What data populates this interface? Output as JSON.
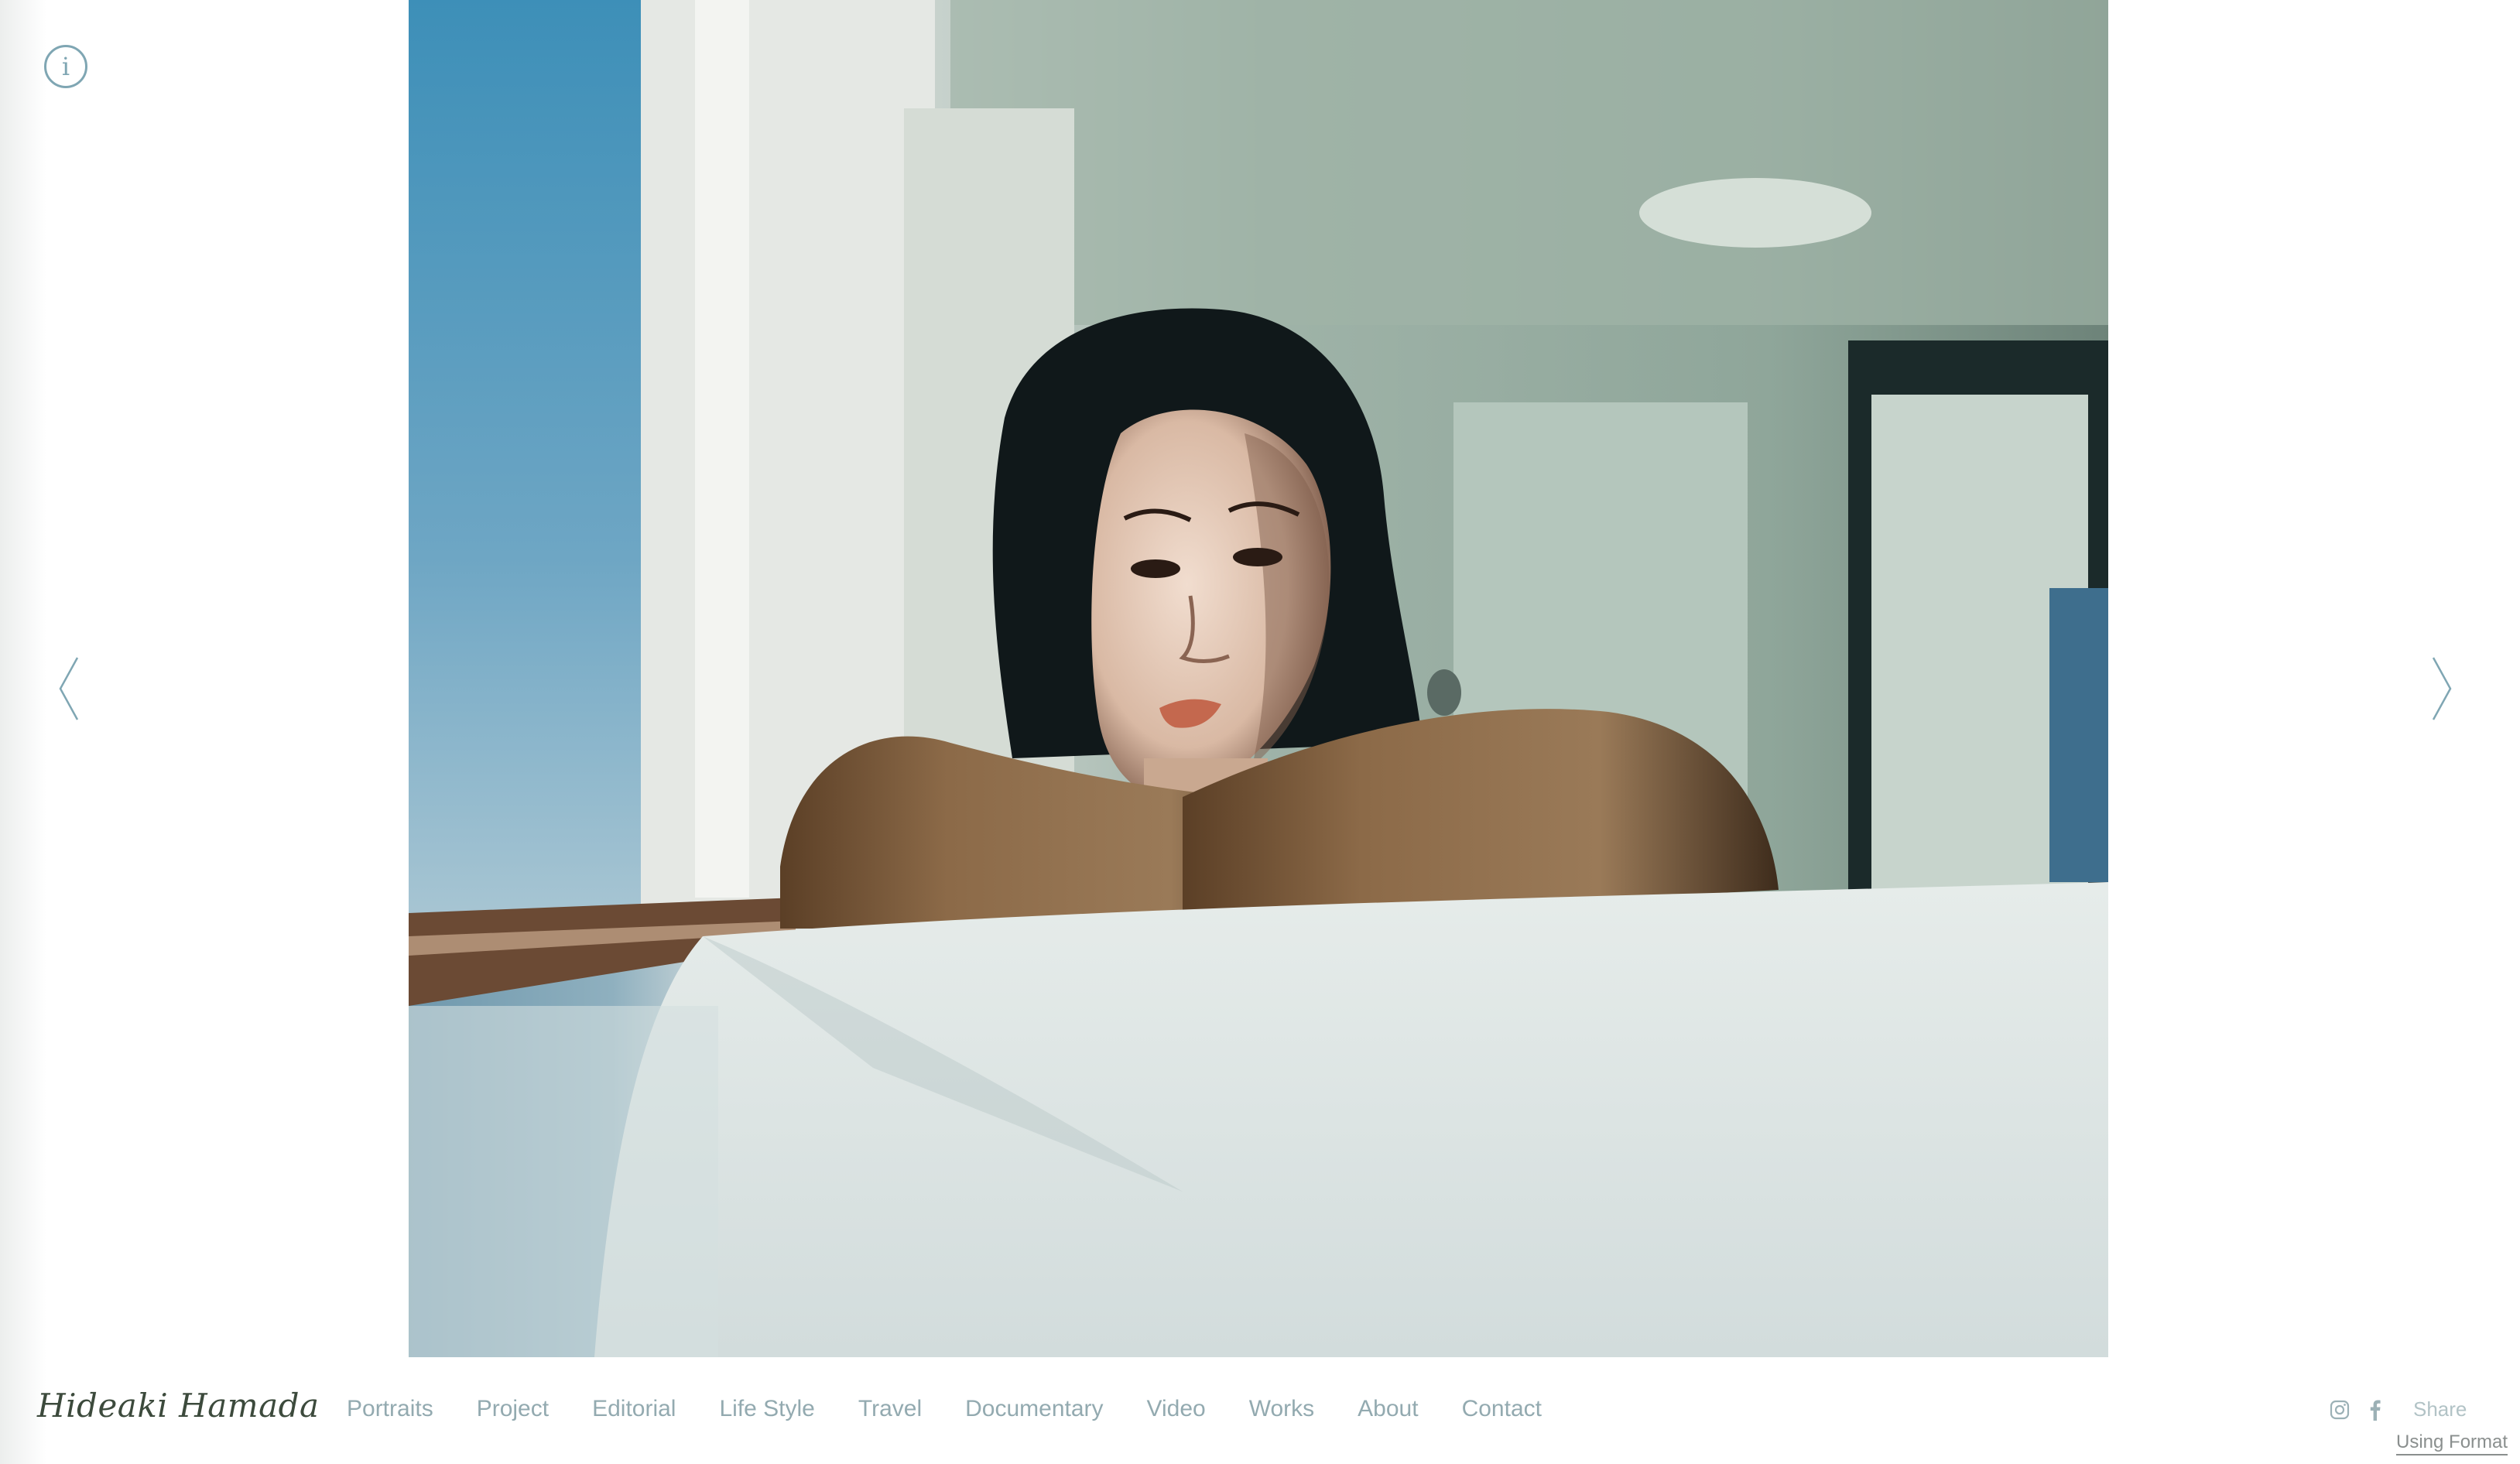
{
  "site": {
    "title": "Hideaki Hamada"
  },
  "nav": {
    "items": [
      {
        "label": "Portraits"
      },
      {
        "label": "Project"
      },
      {
        "label": "Editorial"
      },
      {
        "label": "Life Style"
      },
      {
        "label": "Travel"
      },
      {
        "label": "Documentary"
      },
      {
        "label": "Video"
      },
      {
        "label": "Works"
      },
      {
        "label": "About"
      },
      {
        "label": "Contact"
      }
    ]
  },
  "controls": {
    "info_glyph": "i",
    "prev_icon": "chevron-left-icon",
    "next_icon": "chevron-right-icon"
  },
  "social": {
    "icons": [
      "instagram-icon",
      "facebook-icon"
    ],
    "share_label": "Share"
  },
  "badge": {
    "label": "Using Format"
  },
  "photo": {
    "alt_subject": "portrait photograph"
  },
  "colors": {
    "accent": "#7fa6b3",
    "nav_text": "#93aab0",
    "title_text": "#3c4a3c"
  }
}
